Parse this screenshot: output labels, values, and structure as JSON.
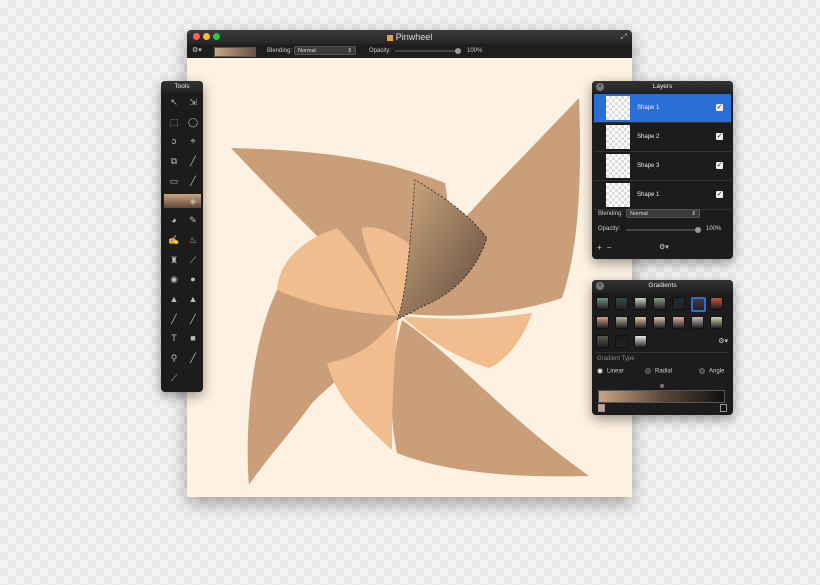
{
  "window": {
    "title": "Pinwheel",
    "blending_label": "Blending:",
    "blending_value": "Normal",
    "opacity_label": "Opacity:",
    "opacity_value": "100%"
  },
  "tools_panel": {
    "title": "Tools",
    "tools": [
      "arrow-select-icon",
      "move-icon",
      "rect-select-icon",
      "ellipse-select-icon",
      "lasso-icon",
      "polygon-lasso-icon",
      "crop-icon",
      "eyedropper-icon",
      "eraser-icon",
      "line-icon",
      "gradient-icon",
      "bucket-icon",
      "smudge-icon",
      "sponge-icon",
      "brush-icon",
      "burn-icon",
      "stamp-icon",
      "pencil-icon",
      "eye-icon",
      "blur-icon",
      "drop-icon",
      "sharpen-icon",
      "pen-icon",
      "path-icon",
      "text-icon",
      "shape-icon",
      "zoom-icon",
      "color-picker-icon",
      "paint-icon"
    ]
  },
  "layers_panel": {
    "title": "Layers",
    "layers": [
      {
        "name": "Shape 1",
        "selected": true,
        "visible": true
      },
      {
        "name": "Shape 2",
        "selected": false,
        "visible": true
      },
      {
        "name": "Shape 3",
        "selected": false,
        "visible": true
      },
      {
        "name": "Shape 1",
        "selected": false,
        "visible": true
      }
    ],
    "blending_label": "Blending:",
    "blending_value": "Normal",
    "opacity_label": "Opacity:",
    "opacity_value": "100%",
    "add_label": "+",
    "remove_label": "−"
  },
  "gradients_panel": {
    "title": "Gradients",
    "type_label": "Gradient Type",
    "types": [
      {
        "label": "Linear",
        "selected": true
      },
      {
        "label": "Radial",
        "selected": false
      },
      {
        "label": "Angle",
        "selected": false
      }
    ],
    "swatches_row1": [
      "#6f8f88",
      "#2f4f48",
      "#c8d8c8",
      "#8a9a88",
      "#1a2a38",
      "#4a3a38",
      "#c05838"
    ],
    "swatches_row2": [
      "#d89a88",
      "#b8b0a0",
      "#e8c8a8",
      "#d8c0b0",
      "#e0a8a0",
      "#c8b8b8",
      "#c8d8a8"
    ],
    "swatches_row3": [
      "#5a5848",
      "#1a1a1a",
      "#e8e8e8"
    ],
    "selected_swatch_color": "#2a6fd6"
  },
  "colors": {
    "canvas_bg": "#fdf1e1",
    "shape_dark": "#c99e79",
    "shape_light": "#f1bd8e",
    "selection_gradient_start": "#d2ab83",
    "selection_gradient_end": "#5e4838"
  }
}
